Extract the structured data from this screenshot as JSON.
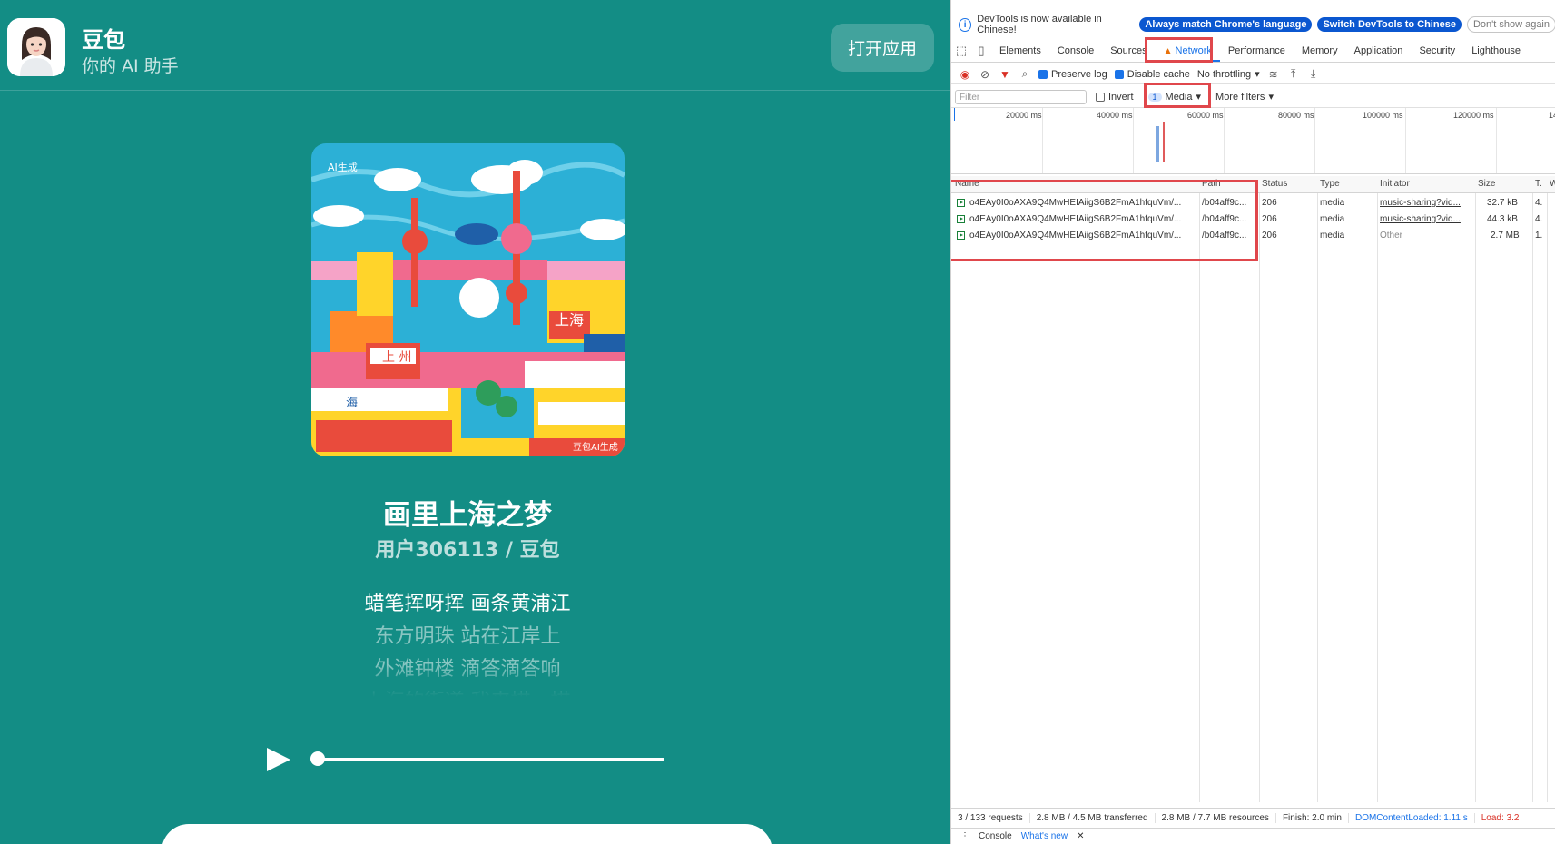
{
  "page": {
    "app_name": "豆包",
    "app_tagline": "你的 AI 助手",
    "open_app_label": "打开应用",
    "song_title": "画里上海之梦",
    "song_artist": "用户306113 / 豆包",
    "lyrics": [
      "蜡笔挥呀挥 画条黄浦江",
      "东方明珠 站在江岸上",
      "外滩钟楼 滴答滴答响",
      "上海的街道 我来描一描"
    ],
    "active_lyric_index": 0,
    "playback_progress": 0.0,
    "cover_text": {
      "ai_tag": "AI生成",
      "top_right_sign": "上海",
      "left_sign": "上 州",
      "bottom_watermark": "豆包AI生成",
      "extra_sign": "海"
    }
  },
  "devtools": {
    "infobar": {
      "message": "DevTools is now available in Chinese!",
      "btn_match": "Always match Chrome's language",
      "btn_switch": "Switch DevTools to Chinese",
      "btn_dismiss": "Don't show again"
    },
    "tabs": [
      "Elements",
      "Console",
      "Sources",
      "Network",
      "Performance",
      "Memory",
      "Application",
      "Security",
      "Lighthouse"
    ],
    "active_tab": "Network",
    "toolbar": {
      "preserve_log": "Preserve log",
      "disable_cache": "Disable cache",
      "throttling": "No throttling"
    },
    "filter": {
      "placeholder": "Filter",
      "invert": "Invert",
      "media_count": "1",
      "media_label": "Media",
      "more_filters": "More filters"
    },
    "timeline_labels": [
      "20000 ms",
      "40000 ms",
      "60000 ms",
      "80000 ms",
      "100000 ms",
      "120000 ms",
      "14"
    ],
    "columns": {
      "name": "Name",
      "path": "Path",
      "status": "Status",
      "type": "Type",
      "initiator": "Initiator",
      "size": "Size",
      "time": "T.",
      "waterfall": "W"
    },
    "rows": [
      {
        "name": "o4EAy0I0oAXA9Q4MwHEIAiigS6B2FmA1hfquVm/...",
        "path": "/b04aff9c...",
        "status": "206",
        "type": "media",
        "initiator": "music-sharing?vid...",
        "size": "32.7 kB",
        "time": "4."
      },
      {
        "name": "o4EAy0I0oAXA9Q4MwHEIAiigS6B2FmA1hfquVm/...",
        "path": "/b04aff9c...",
        "status": "206",
        "type": "media",
        "initiator": "music-sharing?vid...",
        "size": "44.3 kB",
        "time": "4."
      },
      {
        "name": "o4EAy0I0oAXA9Q4MwHEIAiigS6B2FmA1hfquVm/...",
        "path": "/b04aff9c...",
        "status": "206",
        "type": "media",
        "initiator": "Other",
        "size": "2.7 MB",
        "time": "1."
      }
    ],
    "status": {
      "requests": "3 / 133 requests",
      "transferred": "2.8 MB / 4.5 MB transferred",
      "resources": "2.8 MB / 7.7 MB resources",
      "finish": "Finish: 2.0 min",
      "dcl": "DOMContentLoaded: 1.11 s",
      "load": "Load: 3.2"
    },
    "drawer": {
      "console": "Console",
      "whats_new": "What's new"
    },
    "colors": {
      "accent": "#1a73e8",
      "highlight": "#e0474c",
      "page_bg": "#138d85"
    }
  }
}
